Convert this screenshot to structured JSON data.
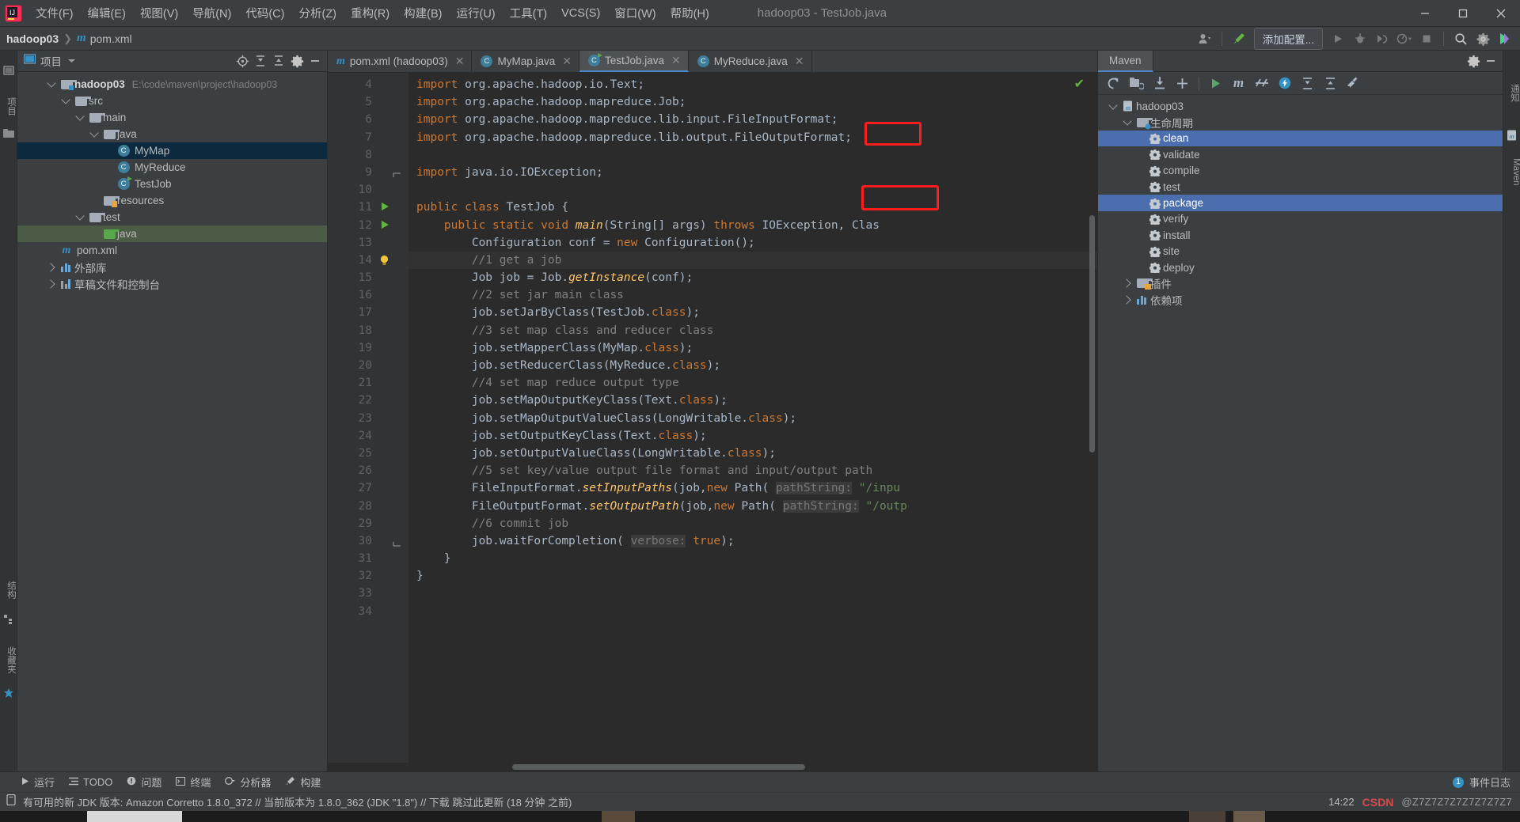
{
  "window": {
    "title": "hadoop03 - TestJob.java",
    "logo_icon": "intellij-logo-icon",
    "minimize_icon": "minimize-icon",
    "maximize_icon": "maximize-icon",
    "close_icon": "close-icon"
  },
  "menubar": [
    {
      "label": "文件(F)"
    },
    {
      "label": "编辑(E)"
    },
    {
      "label": "视图(V)"
    },
    {
      "label": "导航(N)"
    },
    {
      "label": "代码(C)"
    },
    {
      "label": "分析(Z)"
    },
    {
      "label": "重构(R)"
    },
    {
      "label": "构建(B)"
    },
    {
      "label": "运行(U)"
    },
    {
      "label": "工具(T)"
    },
    {
      "label": "VCS(S)"
    },
    {
      "label": "窗口(W)"
    },
    {
      "label": "帮助(H)"
    }
  ],
  "navbar": {
    "project": "hadoop03",
    "separator": "❯",
    "file": "pom.xml",
    "maven_icon": "m",
    "actions": {
      "account_icon": "account-icon",
      "build_icon": "hammer-icon",
      "add_config_label": "添加配置...",
      "run_icon": "run-icon",
      "debug_icon": "debug-icon",
      "run_coverage_icon": "run-with-coverage-icon",
      "profiler_icon": "profiler-icon",
      "stop_icon": "stop-icon",
      "search_icon": "search-icon",
      "settings_icon": "gear-icon",
      "ide_icon": "ide-badge-icon"
    }
  },
  "left_stripe": {
    "items": [
      {
        "label": "项目",
        "icon": "project-icon"
      },
      {
        "label": "",
        "icon": "folder-icon"
      }
    ],
    "bottom_items": [
      {
        "label": "结构",
        "icon": "structure-icon"
      },
      {
        "label": "收藏夹",
        "icon": "favorites-icon"
      }
    ]
  },
  "project_panel": {
    "title": "项目",
    "title_icon": "project-icon",
    "dropdown_icon": "chevron-down-icon",
    "actions": [
      {
        "name": "locate-icon"
      },
      {
        "name": "expand-all-icon"
      },
      {
        "name": "collapse-all-icon"
      },
      {
        "name": "gear-icon"
      },
      {
        "name": "hide-icon"
      }
    ],
    "tree": [
      {
        "indent": 0,
        "label": "hadoop03",
        "path": "E:\\code\\maven\\project\\hadoop03",
        "icon": "module-folder-icon",
        "expanded": true,
        "bold": true,
        "state": "none"
      },
      {
        "indent": 1,
        "label": "src",
        "icon": "folder-icon",
        "expanded": true,
        "state": "none"
      },
      {
        "indent": 2,
        "label": "main",
        "icon": "folder-icon",
        "expanded": true,
        "state": "none"
      },
      {
        "indent": 3,
        "label": "java",
        "icon": "source-folder-icon",
        "expanded": true,
        "state": "none"
      },
      {
        "indent": 4,
        "label": "MyMap",
        "icon": "java-class-icon",
        "state": "selected"
      },
      {
        "indent": 4,
        "label": "MyReduce",
        "icon": "java-class-icon",
        "state": "none"
      },
      {
        "indent": 4,
        "label": "TestJob",
        "icon": "java-runnable-class-icon",
        "state": "none"
      },
      {
        "indent": 3,
        "label": "resources",
        "icon": "resources-folder-icon",
        "state": "none"
      },
      {
        "indent": 2,
        "label": "test",
        "icon": "folder-icon",
        "expanded": true,
        "state": "none"
      },
      {
        "indent": 3,
        "label": "java",
        "icon": "test-source-folder-icon",
        "state": "highlight"
      },
      {
        "indent": 1,
        "label": "pom.xml",
        "icon": "maven-pom-icon",
        "state": "none"
      },
      {
        "indent": 0,
        "label": "外部库",
        "icon": "external-libraries-icon",
        "collapsed": true,
        "state": "none"
      },
      {
        "indent": 0,
        "label": "草稿文件和控制台",
        "icon": "scratches-icon",
        "collapsed": true,
        "state": "none"
      }
    ]
  },
  "editor": {
    "tabs": [
      {
        "label": "pom.xml (hadoop03)",
        "icon": "maven-pom-icon",
        "active": false,
        "closable": true
      },
      {
        "label": "MyMap.java",
        "icon": "java-class-icon",
        "active": false,
        "closable": true
      },
      {
        "label": "TestJob.java",
        "icon": "java-runnable-class-icon",
        "active": true,
        "closable": true
      },
      {
        "label": "MyReduce.java",
        "icon": "java-class-icon",
        "active": false,
        "closable": true
      }
    ],
    "inspection_status_icon": "check-ok-icon",
    "first_line_number": 4,
    "lines": [
      {
        "n": 4,
        "gutter": ""
      },
      {
        "n": 5,
        "gutter": ""
      },
      {
        "n": 6,
        "gutter": ""
      },
      {
        "n": 7,
        "gutter": ""
      },
      {
        "n": 8,
        "gutter": ""
      },
      {
        "n": 9,
        "gutter": "fold"
      },
      {
        "n": 10,
        "gutter": ""
      },
      {
        "n": 11,
        "gutter": "run"
      },
      {
        "n": 12,
        "gutter": "run"
      },
      {
        "n": 13,
        "gutter": ""
      },
      {
        "n": 14,
        "gutter": "bulb"
      },
      {
        "n": 15,
        "gutter": ""
      },
      {
        "n": 16,
        "gutter": ""
      },
      {
        "n": 17,
        "gutter": ""
      },
      {
        "n": 18,
        "gutter": ""
      },
      {
        "n": 19,
        "gutter": ""
      },
      {
        "n": 20,
        "gutter": ""
      },
      {
        "n": 21,
        "gutter": ""
      },
      {
        "n": 22,
        "gutter": ""
      },
      {
        "n": 23,
        "gutter": ""
      },
      {
        "n": 24,
        "gutter": ""
      },
      {
        "n": 25,
        "gutter": ""
      },
      {
        "n": 26,
        "gutter": ""
      },
      {
        "n": 27,
        "gutter": ""
      },
      {
        "n": 28,
        "gutter": ""
      },
      {
        "n": 29,
        "gutter": ""
      },
      {
        "n": 30,
        "gutter": ""
      },
      {
        "n": 31,
        "gutter": "fold"
      },
      {
        "n": 32,
        "gutter": ""
      },
      {
        "n": 33,
        "gutter": ""
      },
      {
        "n": 34,
        "gutter": ""
      }
    ],
    "code_text": [
      "import org.apache.hadoop.io.Text;",
      "import org.apache.hadoop.mapreduce.Job;",
      "import org.apache.hadoop.mapreduce.lib.input.FileInputFormat;",
      "import org.apache.hadoop.mapreduce.lib.output.FileOutputFormat;",
      "",
      "import java.io.IOException;",
      "",
      "public class TestJob {",
      "    public static void main(String[] args) throws IOException, ClassNotFoundException",
      "        Configuration conf = new Configuration();",
      "        //1 get a job",
      "        Job job = Job.getInstance(conf);",
      "        //2 set jar main class",
      "        job.setJarByClass(TestJob.class);",
      "        //3 set map class and reducer class",
      "        job.setMapperClass(MyMap.class);",
      "        job.setReducerClass(MyReduce.class);",
      "        //4 set map reduce output type",
      "        job.setMapOutputKeyClass(Text.class);",
      "        job.setMapOutputValueClass(LongWritable.class);",
      "        job.setOutputKeyClass(Text.class);",
      "        job.setOutputValueClass(LongWritable.class);",
      "        //5 set key/value output file format and input/output path",
      "        FileInputFormat.setInputPaths(job,new Path( pathString: \"/input\"",
      "        FileOutputFormat.setOutputPath(job,new Path( pathString: \"/outp",
      "        //6 commit job",
      "        job.waitForCompletion( verbose: true);",
      "    }",
      "}",
      "",
      ""
    ]
  },
  "maven_panel": {
    "tab_label": "Maven",
    "header_actions": [
      {
        "name": "gear-icon"
      },
      {
        "name": "hide-icon"
      }
    ],
    "toolbar": [
      {
        "name": "reload-icon"
      },
      {
        "name": "add-maven-project-icon"
      },
      {
        "name": "download-sources-icon"
      },
      {
        "name": "add-icon"
      },
      {
        "name": "run-maven-build-icon"
      },
      {
        "name": "execute-maven-goal-icon"
      },
      {
        "name": "toggle-skip-tests-icon"
      },
      {
        "name": "toggle-offline-icon"
      },
      {
        "name": "expand-all-icon"
      },
      {
        "name": "collapse-all-icon"
      },
      {
        "name": "maven-settings-icon"
      }
    ],
    "right_stripe_label": "Maven",
    "tree": [
      {
        "indent": 0,
        "label": "hadoop03",
        "icon": "maven-project-icon",
        "expanded": true,
        "state": "none"
      },
      {
        "indent": 1,
        "label": "生命周期",
        "icon": "lifecycle-folder-icon",
        "expanded": true,
        "state": "none"
      },
      {
        "indent": 2,
        "label": "clean",
        "icon": "maven-goal-icon",
        "state": "selected",
        "annotated": true
      },
      {
        "indent": 2,
        "label": "validate",
        "icon": "maven-goal-icon",
        "state": "none"
      },
      {
        "indent": 2,
        "label": "compile",
        "icon": "maven-goal-icon",
        "state": "none"
      },
      {
        "indent": 2,
        "label": "test",
        "icon": "maven-goal-icon",
        "state": "none"
      },
      {
        "indent": 2,
        "label": "package",
        "icon": "maven-goal-icon",
        "state": "selected",
        "annotated": true
      },
      {
        "indent": 2,
        "label": "verify",
        "icon": "maven-goal-icon",
        "state": "none"
      },
      {
        "indent": 2,
        "label": "install",
        "icon": "maven-goal-icon",
        "state": "none"
      },
      {
        "indent": 2,
        "label": "site",
        "icon": "maven-goal-icon",
        "state": "none"
      },
      {
        "indent": 2,
        "label": "deploy",
        "icon": "maven-goal-icon",
        "state": "none"
      },
      {
        "indent": 1,
        "label": "插件",
        "icon": "plugins-folder-icon",
        "collapsed": true,
        "state": "none"
      },
      {
        "indent": 1,
        "label": "依赖项",
        "icon": "dependencies-folder-icon",
        "collapsed": true,
        "state": "none"
      }
    ],
    "annotation_color": "#ff1c1c"
  },
  "bottom_toolwindows": [
    {
      "label": "运行",
      "icon": "run-icon"
    },
    {
      "label": "TODO",
      "icon": "todo-icon"
    },
    {
      "label": "问题",
      "icon": "problems-icon"
    },
    {
      "label": "终端",
      "icon": "terminal-icon"
    },
    {
      "label": "分析器",
      "icon": "profiler-icon"
    },
    {
      "label": "构建",
      "icon": "build-icon"
    }
  ],
  "bottom_right": {
    "event_count": "1",
    "event_log_label": "事件日志"
  },
  "statusbar": {
    "icon": "notification-icon",
    "message": "有可用的新 JDK 版本: Amazon Corretto 1.8.0_372 // 当前版本为 1.8.0_362 (JDK \"1.8\") // 下载  跳过此更新 (18 分钟 之前)",
    "time": "14:22",
    "watermark_brand": "CSDN",
    "watermark_text": "@Z7Z7Z7Z7Z7Z7Z7Z7"
  }
}
